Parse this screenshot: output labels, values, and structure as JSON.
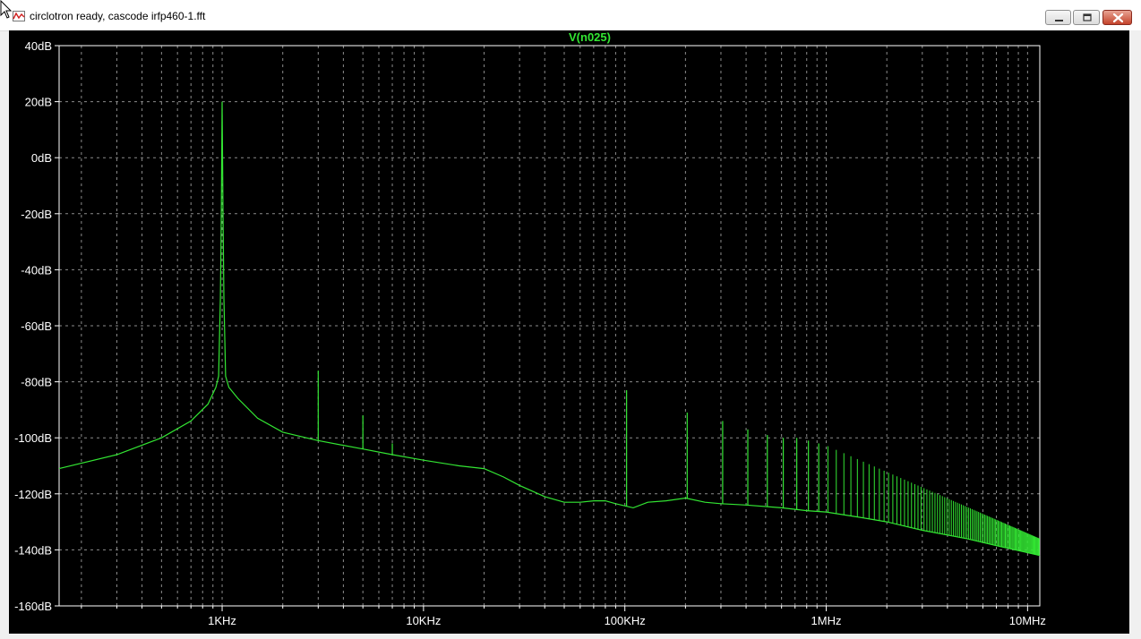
{
  "window": {
    "title": "circlotron ready, cascode irfp460-1.fft"
  },
  "icons": {
    "app": "waveform-icon",
    "cursor": "mouse-pointer-icon",
    "minimize": "minimize-icon",
    "maximize": "maximize-icon",
    "close": "close-icon"
  },
  "colors": {
    "plot_background": "#000000",
    "trace": "#33e633",
    "axis_text": "#ffffff",
    "grid": "#8c8c8c",
    "trace_label": "#33e633"
  },
  "chart_data": {
    "type": "line",
    "trace_label": "V(n025)",
    "x_scale": "log",
    "x_unit": "Hz",
    "xlim": [
      155,
      11500000
    ],
    "ylim": [
      -160,
      40
    ],
    "x_ticks": [
      {
        "value": 1000,
        "label": "1KHz"
      },
      {
        "value": 10000,
        "label": "10KHz"
      },
      {
        "value": 100000,
        "label": "100KHz"
      },
      {
        "value": 1000000,
        "label": "1MHz"
      },
      {
        "value": 10000000,
        "label": "10MHz"
      }
    ],
    "y_ticks": [
      {
        "value": 40,
        "label": "40dB"
      },
      {
        "value": 20,
        "label": "20dB"
      },
      {
        "value": 0,
        "label": "0dB"
      },
      {
        "value": -20,
        "label": "-20dB"
      },
      {
        "value": -40,
        "label": "-40dB"
      },
      {
        "value": -60,
        "label": "-60dB"
      },
      {
        "value": -80,
        "label": "-80dB"
      },
      {
        "value": -100,
        "label": "-100dB"
      },
      {
        "value": -120,
        "label": "-120dB"
      },
      {
        "value": -140,
        "label": "-140dB"
      },
      {
        "value": -160,
        "label": "-160dB"
      }
    ],
    "grid": true,
    "noise_floor": [
      [
        155,
        -111
      ],
      [
        300,
        -106
      ],
      [
        500,
        -100
      ],
      [
        700,
        -94
      ],
      [
        850,
        -88
      ],
      [
        930,
        -82
      ],
      [
        960,
        -78
      ],
      [
        980,
        -50
      ],
      [
        990,
        -20
      ],
      [
        1000,
        20
      ],
      [
        1010,
        -20
      ],
      [
        1020,
        -50
      ],
      [
        1040,
        -78
      ],
      [
        1080,
        -82
      ],
      [
        1200,
        -86
      ],
      [
        1500,
        -93
      ],
      [
        2000,
        -98
      ],
      [
        3000,
        -101
      ],
      [
        5000,
        -104
      ],
      [
        7000,
        -106
      ],
      [
        10000,
        -108
      ],
      [
        15000,
        -110
      ],
      [
        20000,
        -111
      ],
      [
        25000,
        -114
      ],
      [
        30000,
        -117
      ],
      [
        40000,
        -121
      ],
      [
        50000,
        -123
      ],
      [
        60000,
        -123
      ],
      [
        70000,
        -122.5
      ],
      [
        80000,
        -122.5
      ],
      [
        90000,
        -123.5
      ],
      [
        110000,
        -125
      ],
      [
        130000,
        -123
      ],
      [
        160000,
        -122.5
      ],
      [
        200000,
        -121.5
      ],
      [
        250000,
        -123
      ],
      [
        300000,
        -123.5
      ],
      [
        400000,
        -124
      ],
      [
        600000,
        -125
      ],
      [
        800000,
        -126
      ],
      [
        1000000,
        -126.5
      ],
      [
        1500000,
        -128.5
      ],
      [
        2000000,
        -130
      ],
      [
        3000000,
        -133
      ],
      [
        5000000,
        -136
      ],
      [
        7000000,
        -138.5
      ],
      [
        10000000,
        -141
      ],
      [
        11500000,
        -142
      ]
    ],
    "harmonics": [
      {
        "f": 3000,
        "db": -76
      },
      {
        "f": 5000,
        "db": -92
      },
      {
        "f": 7000,
        "db": -102
      },
      {
        "f": 102000,
        "db": -83
      },
      {
        "f": 204000,
        "db": -91
      },
      {
        "f": 306000,
        "db": -94
      },
      {
        "f": 408000,
        "db": -97
      },
      {
        "f": 510000,
        "db": -99
      },
      {
        "f": 612000,
        "db": -100
      },
      {
        "f": 714000,
        "db": -100
      },
      {
        "f": 816000,
        "db": -101
      },
      {
        "f": 918000,
        "db": -102
      }
    ],
    "spur_series": {
      "f_start": 1020000,
      "f_step": 102000,
      "f_end": 11500000,
      "db_start": -103,
      "db_end": -136
    }
  }
}
